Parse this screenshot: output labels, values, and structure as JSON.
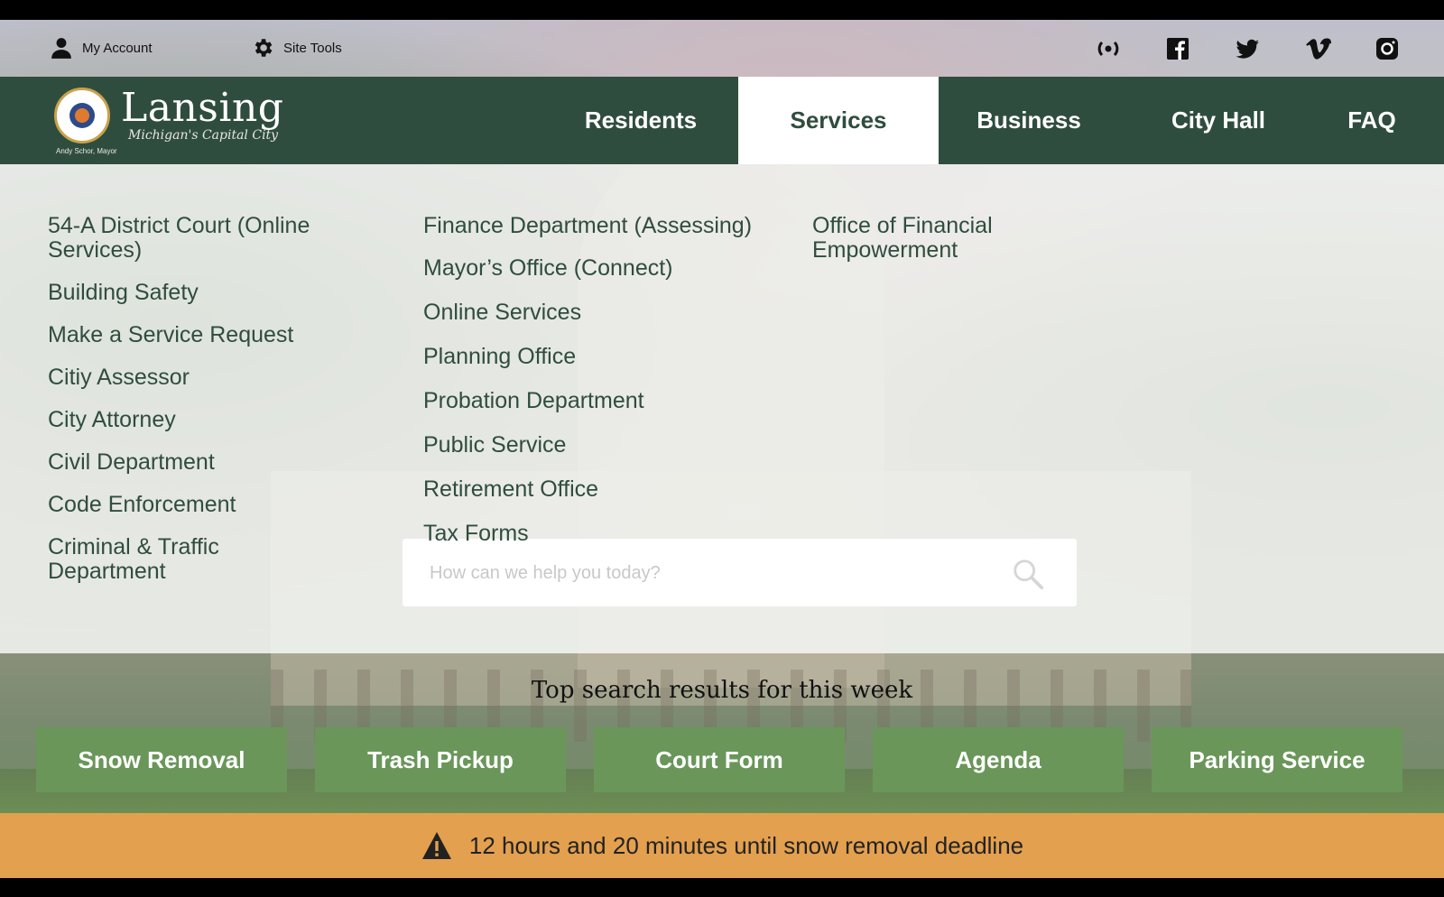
{
  "utility": {
    "account_label": "My Account",
    "tools_label": "Site Tools",
    "social": [
      "broadcast-icon",
      "facebook-icon",
      "twitter-icon",
      "vimeo-icon",
      "instagram-icon"
    ]
  },
  "brand": {
    "name": "Lansing",
    "tagline": "Michigan's Capital City",
    "seal_caption": "Andy Schor, Mayor"
  },
  "nav": {
    "items": [
      "Residents",
      "Services",
      "Business",
      "City Hall",
      "FAQ"
    ],
    "active": "Services"
  },
  "mega_menu": {
    "col1": [
      "54-A District Court (Online Services)",
      "Building Safety",
      "Make a Service Request",
      "Citiy Assessor",
      "City Attorney",
      "Civil Department",
      "Code Enforcement",
      "Criminal & Traffic Department"
    ],
    "col2": [
      "Finance Department (Assessing)",
      "Mayor’s Office (Connect)",
      "Online Services",
      "Planning Office",
      "Probation Department",
      "Public Service",
      "Retirement Office",
      "Tax Forms"
    ],
    "col3": [
      "Office of Financial Empowerment"
    ]
  },
  "search": {
    "placeholder": "How can we help you today?"
  },
  "top_searches": {
    "heading": "Top search results for this week",
    "items": [
      "Snow Removal",
      "Trash Pickup",
      "Court Form",
      "Agenda",
      "Parking Service"
    ]
  },
  "alert": {
    "text": "12 hours and 20 minutes until snow removal deadline"
  },
  "colors": {
    "nav_green": "#2f4d3e",
    "button_green": "#6a965a",
    "alert_orange": "#e3a04e"
  }
}
